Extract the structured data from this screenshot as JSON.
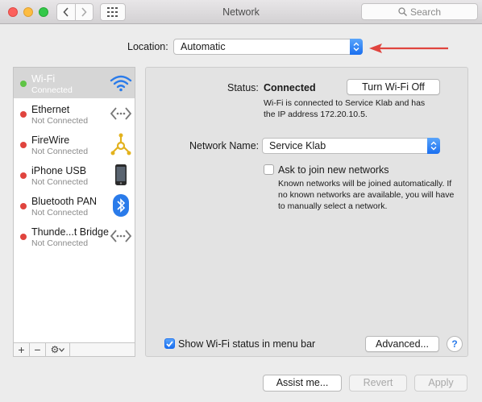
{
  "window": {
    "title": "Network"
  },
  "toolbar": {
    "search_placeholder": "Search"
  },
  "location": {
    "label": "Location:",
    "value": "Automatic"
  },
  "services": [
    {
      "name": "Wi-Fi",
      "status": "Connected",
      "dot_color": "#5fc445",
      "icon": "wifi-icon",
      "selected": true
    },
    {
      "name": "Ethernet",
      "status": "Not Connected",
      "dot_color": "#e0443e",
      "icon": "ethernet-icon",
      "selected": false
    },
    {
      "name": "FireWire",
      "status": "Not Connected",
      "dot_color": "#e0443e",
      "icon": "firewire-icon",
      "selected": false
    },
    {
      "name": "iPhone USB",
      "status": "Not Connected",
      "dot_color": "#e0443e",
      "icon": "iphone-icon",
      "selected": false
    },
    {
      "name": "Bluetooth PAN",
      "status": "Not Connected",
      "dot_color": "#e0443e",
      "icon": "bluetooth-icon",
      "selected": false
    },
    {
      "name": "Thunde...t Bridge",
      "status": "Not Connected",
      "dot_color": "#e0443e",
      "icon": "thunderbolt-bridge-icon",
      "selected": false
    }
  ],
  "sidebar_actions": {
    "add": "+",
    "remove": "−",
    "gear": "⚙"
  },
  "detail": {
    "status_label": "Status:",
    "status_value": "Connected",
    "turn_off_button": "Turn Wi-Fi Off",
    "status_desc_line1": "Wi-Fi is connected to Service Klab and has",
    "status_desc_line2": "the IP address 172.20.10.5.",
    "network_name_label": "Network Name:",
    "network_name_value": "Service Klab",
    "ask_join_label": "Ask to join new networks",
    "ask_join_checked": false,
    "ask_desc_line1": "Known networks will be joined automatically. If",
    "ask_desc_line2": "no known networks are available, you will have",
    "ask_desc_line3": "to manually select a network.",
    "show_status_label": "Show Wi-Fi status in menu bar",
    "show_status_checked": true,
    "advanced_button": "Advanced...",
    "help_button": "?"
  },
  "footer": {
    "assist_button": "Assist me...",
    "revert_button": "Revert",
    "apply_button": "Apply"
  },
  "colors": {
    "accent": "#1a6ff0",
    "annotation_arrow": "#e0443e",
    "selection": "#d6d6d6"
  }
}
